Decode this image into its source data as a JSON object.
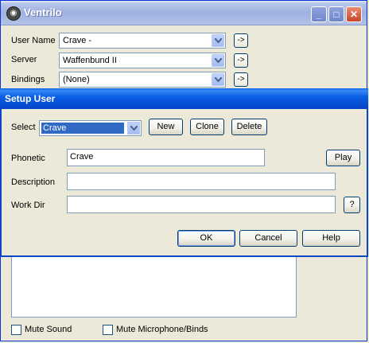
{
  "window": {
    "title": "Ventrilo",
    "minimize_label": "_",
    "maximize_label": "□",
    "close_label": "✕"
  },
  "main": {
    "user_name_label": "User Name",
    "user_name_value": "Crave -",
    "server_label": "Server",
    "server_value": "Waffenbund II",
    "bindings_label": "Bindings",
    "bindings_value": "(None)",
    "arrow_button_label": "->",
    "mute_sound_label": "Mute Sound",
    "mute_mic_label": "Mute Microphone/Binds"
  },
  "dialog": {
    "title": "Setup User",
    "select_label": "Select",
    "select_value": "Crave",
    "new_label": "New",
    "clone_label": "Clone",
    "delete_label": "Delete",
    "phonetic_label": "Phonetic",
    "phonetic_value": "Crave",
    "play_label": "Play",
    "description_label": "Description",
    "description_value": "",
    "workdir_label": "Work Dir",
    "workdir_value": "",
    "help_q_label": "?",
    "ok_label": "OK",
    "cancel_label": "Cancel",
    "help_label": "Help"
  }
}
